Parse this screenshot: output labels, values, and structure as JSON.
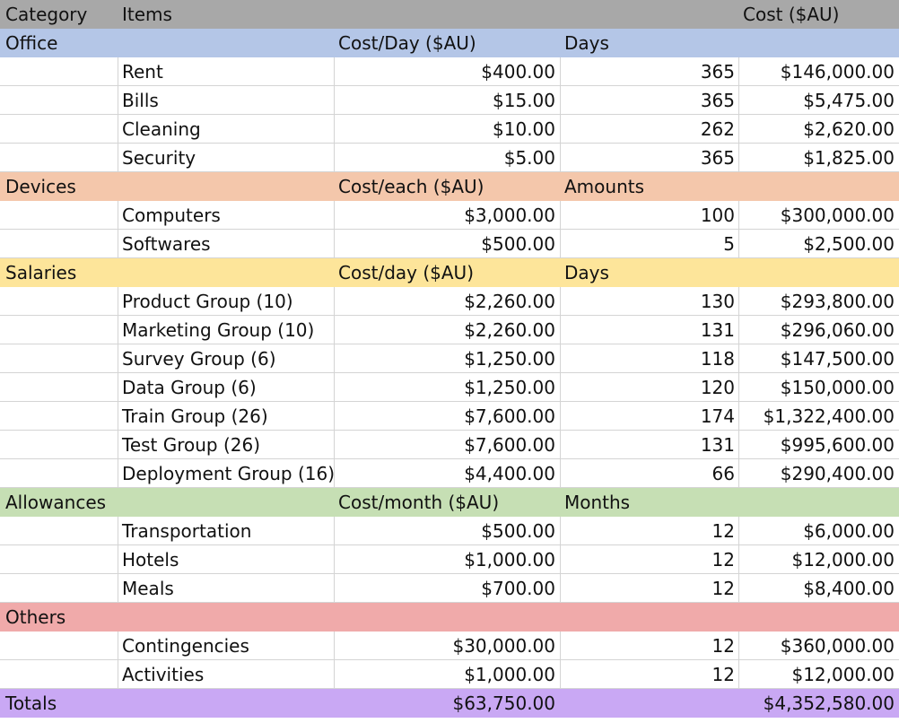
{
  "colors": {
    "header": "#a8a8a8",
    "office": "#b4c6e7",
    "devices": "#f4c7ab",
    "salaries": "#fde59a",
    "allowances": "#c6dfb4",
    "others": "#f0aaaa",
    "totals": "#c9a8f4"
  },
  "header": {
    "category": "Category",
    "items": "Items",
    "cost": "Cost ($AU)"
  },
  "sections": [
    {
      "name": "Office",
      "color": "#b4c6e7",
      "rate_label": "Cost/Day ($AU)",
      "qty_label": "Days",
      "rows": [
        {
          "item": "Rent",
          "rate": "$400.00",
          "qty": "365",
          "cost": "$146,000.00"
        },
        {
          "item": "Bills",
          "rate": "$15.00",
          "qty": "365",
          "cost": "$5,475.00"
        },
        {
          "item": "Cleaning",
          "rate": "$10.00",
          "qty": "262",
          "cost": "$2,620.00"
        },
        {
          "item": "Security",
          "rate": "$5.00",
          "qty": "365",
          "cost": "$1,825.00"
        }
      ]
    },
    {
      "name": "Devices",
      "color": "#f4c7ab",
      "rate_label": "Cost/each ($AU)",
      "qty_label": "Amounts",
      "rows": [
        {
          "item": "Computers",
          "rate": "$3,000.00",
          "qty": "100",
          "cost": "$300,000.00"
        },
        {
          "item": "Softwares",
          "rate": "$500.00",
          "qty": "5",
          "cost": "$2,500.00"
        }
      ]
    },
    {
      "name": "Salaries",
      "color": "#fde59a",
      "rate_label": "Cost/day ($AU)",
      "qty_label": "Days",
      "rows": [
        {
          "item": "Product Group (10)",
          "rate": "$2,260.00",
          "qty": "130",
          "cost": "$293,800.00"
        },
        {
          "item": "Marketing Group (10)",
          "rate": "$2,260.00",
          "qty": "131",
          "cost": "$296,060.00"
        },
        {
          "item": "Survey Group (6)",
          "rate": "$1,250.00",
          "qty": "118",
          "cost": "$147,500.00"
        },
        {
          "item": "Data Group (6)",
          "rate": "$1,250.00",
          "qty": "120",
          "cost": "$150,000.00"
        },
        {
          "item": "Train Group (26)",
          "rate": "$7,600.00",
          "qty": "174",
          "cost": "$1,322,400.00"
        },
        {
          "item": "Test Group (26)",
          "rate": "$7,600.00",
          "qty": "131",
          "cost": "$995,600.00"
        },
        {
          "item": "Deployment Group (16)",
          "rate": "$4,400.00",
          "qty": "66",
          "cost": "$290,400.00"
        }
      ]
    },
    {
      "name": "Allowances",
      "color": "#c6dfb4",
      "rate_label": "Cost/month ($AU)",
      "qty_label": "Months",
      "rows": [
        {
          "item": "Transportation",
          "rate": "$500.00",
          "qty": "12",
          "cost": "$6,000.00"
        },
        {
          "item": "Hotels",
          "rate": "$1,000.00",
          "qty": "12",
          "cost": "$12,000.00"
        },
        {
          "item": "Meals",
          "rate": "$700.00",
          "qty": "12",
          "cost": "$8,400.00"
        }
      ]
    },
    {
      "name": "Others",
      "color": "#f0aaaa",
      "rate_label": "",
      "qty_label": "",
      "rows": [
        {
          "item": "Contingencies",
          "rate": "$30,000.00",
          "qty": "12",
          "cost": "$360,000.00"
        },
        {
          "item": "Activities",
          "rate": "$1,000.00",
          "qty": "12",
          "cost": "$12,000.00"
        }
      ]
    }
  ],
  "totals": {
    "label": "Totals",
    "color": "#c9a8f4",
    "rate_total": "$63,750.00",
    "cost_total": "$4,352,580.00"
  }
}
